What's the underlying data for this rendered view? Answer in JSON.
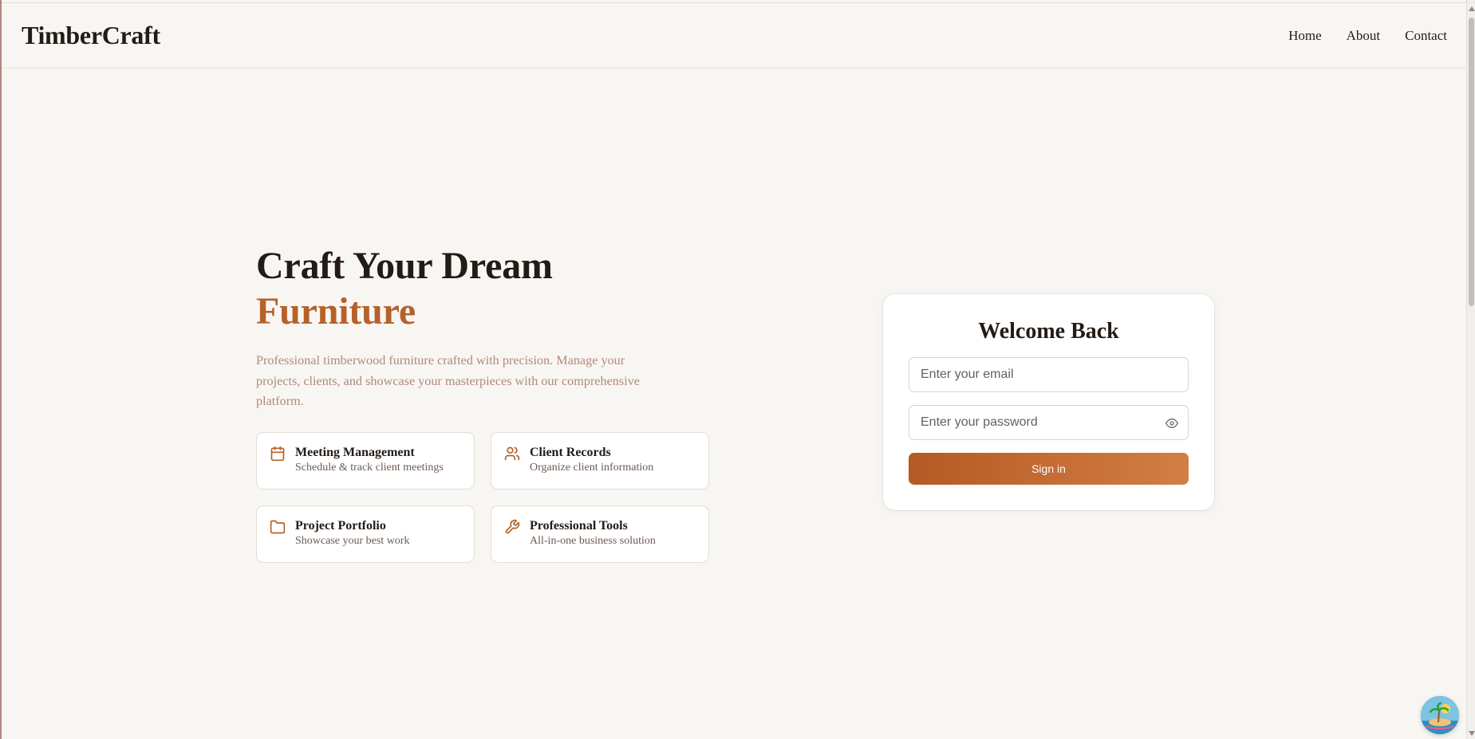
{
  "header": {
    "brand": "TimberCraft",
    "nav": [
      {
        "label": "Home"
      },
      {
        "label": "About"
      },
      {
        "label": "Contact"
      }
    ]
  },
  "hero": {
    "title_line1": "Craft Your Dream",
    "title_line2": "Furniture",
    "lead": "Professional timberwood furniture crafted with precision. Manage your projects, clients, and showcase your masterpieces with our comprehensive platform."
  },
  "features": [
    {
      "icon": "calendar-icon",
      "title": "Meeting Management",
      "desc": "Schedule & track client meetings"
    },
    {
      "icon": "users-icon",
      "title": "Client Records",
      "desc": "Organize client information"
    },
    {
      "icon": "folder-icon",
      "title": "Project Portfolio",
      "desc": "Showcase your best work"
    },
    {
      "icon": "wrench-icon",
      "title": "Professional Tools",
      "desc": "All-in-one business solution"
    }
  ],
  "login": {
    "title": "Welcome Back",
    "email_placeholder": "Enter your email",
    "password_placeholder": "Enter your password",
    "submit_label": "Sign in"
  },
  "colors": {
    "accent": "#b5612a",
    "button_start": "#b45a24",
    "button_end": "#d27e44",
    "background": "#f8f6f3"
  }
}
